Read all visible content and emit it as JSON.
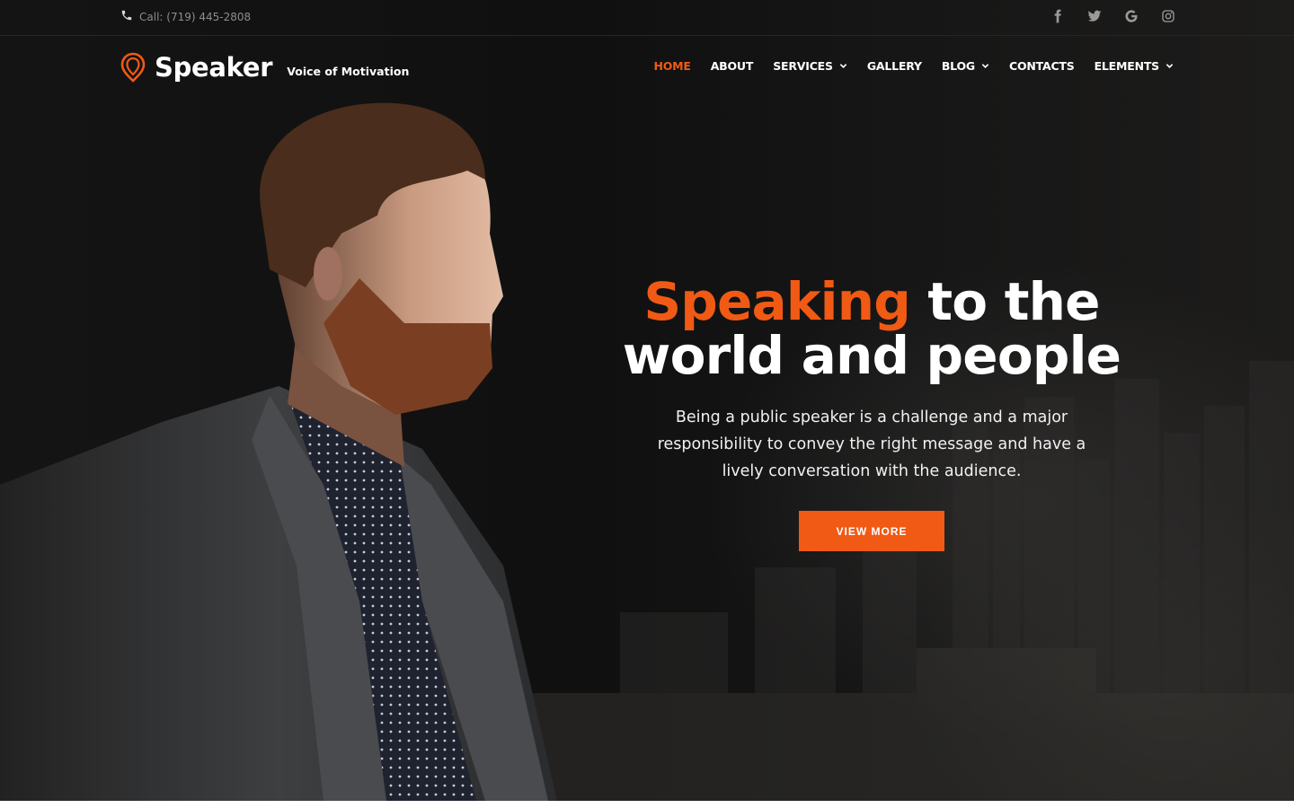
{
  "topbar": {
    "phone": "Call: (719) 445-2808",
    "socials": [
      {
        "icon": "facebook-icon"
      },
      {
        "icon": "twitter-icon"
      },
      {
        "icon": "google-icon"
      },
      {
        "icon": "instagram-icon"
      }
    ]
  },
  "header": {
    "brand": "Speaker",
    "tagline": "Voice of Motivation"
  },
  "nav": {
    "items": [
      {
        "label": "HOME",
        "active": true
      },
      {
        "label": "ABOUT"
      },
      {
        "label": "SERVICES",
        "dropdown": true
      },
      {
        "label": "GALLERY"
      },
      {
        "label": "BLOG",
        "dropdown": true
      },
      {
        "label": "CONTACTS"
      },
      {
        "label": "ELEMENTS",
        "dropdown": true
      }
    ]
  },
  "hero": {
    "headline_accent": "Speaking",
    "headline_rest_1": " to the",
    "headline_line_2": "world and people",
    "lead": "Being a public speaker is a challenge and a major responsibility to convey the right message and have a lively conversation with the audience.",
    "cta": "VIEW MORE"
  },
  "colors": {
    "accent": "#f05a14",
    "background": "#121212"
  }
}
